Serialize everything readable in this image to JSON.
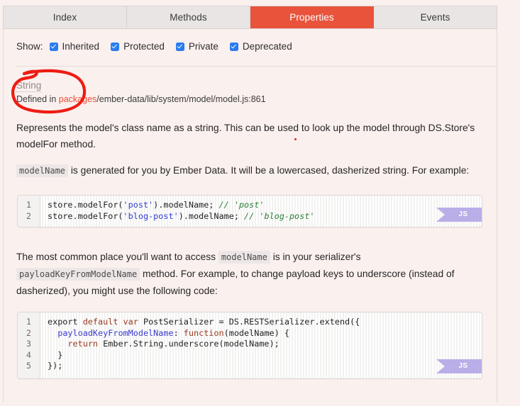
{
  "theme": {
    "page_bg": "#faf0ee",
    "active_tab_bg": "#e9533c",
    "checkbox_color": "#2b7cf0",
    "link_color": "#e8503a",
    "annotation_color": "#ee1c12",
    "badge_color": "#b9aee8"
  },
  "tabs": [
    {
      "label": "Index",
      "active": false
    },
    {
      "label": "Methods",
      "active": false
    },
    {
      "label": "Properties",
      "active": true
    },
    {
      "label": "Events",
      "active": false
    }
  ],
  "filters": {
    "show_label": "Show:",
    "options": [
      {
        "label": "Inherited",
        "checked": true
      },
      {
        "label": "Protected",
        "checked": true
      },
      {
        "label": "Private",
        "checked": true
      },
      {
        "label": "Deprecated",
        "checked": true
      }
    ]
  },
  "item": {
    "type": "String",
    "defined_in_prefix": "Defined in ",
    "defined_in_link": "packages",
    "defined_in_rest": "/ember-data/lib/system/model/model.js:861"
  },
  "body": {
    "paragraph1": "Represents the model's class name as a string. This can be used to look up the model through DS.Store's modelFor method.",
    "paragraph2_code": "modelName",
    "paragraph2_text": " is generated for you by Ember Data. It will be a lowercased, dasherized string. For example:",
    "paragraph3_pre": "The most common place you'll want to access ",
    "paragraph3_code1": "modelName",
    "paragraph3_mid": " is in your serializer's ",
    "paragraph3_code2": "payloadKeyFromModelName",
    "paragraph3_post": " method. For example, to change payload keys to underscore (instead of dasherized), you might use the following code:"
  },
  "code_blocks": [
    {
      "language_badge": "JS",
      "line_numbers": [
        "1",
        "2"
      ],
      "lines": [
        "store.modelFor('post').modelName; // 'post'",
        "store.modelFor('blog-post').modelName; // 'blog-post'"
      ]
    },
    {
      "language_badge": "JS",
      "line_numbers": [
        "1",
        "2",
        "3",
        "4",
        "5"
      ],
      "lines": [
        "export default var PostSerializer = DS.RESTSerializer.extend({",
        "  payloadKeyFromModelName: function(modelName) {",
        "    return Ember.String.underscore(modelName);",
        "  }",
        "});"
      ]
    }
  ],
  "annotations": [
    {
      "type": "hand-drawn-ellipse",
      "target": "item-header"
    },
    {
      "type": "dot",
      "target": "paragraph1"
    }
  ]
}
